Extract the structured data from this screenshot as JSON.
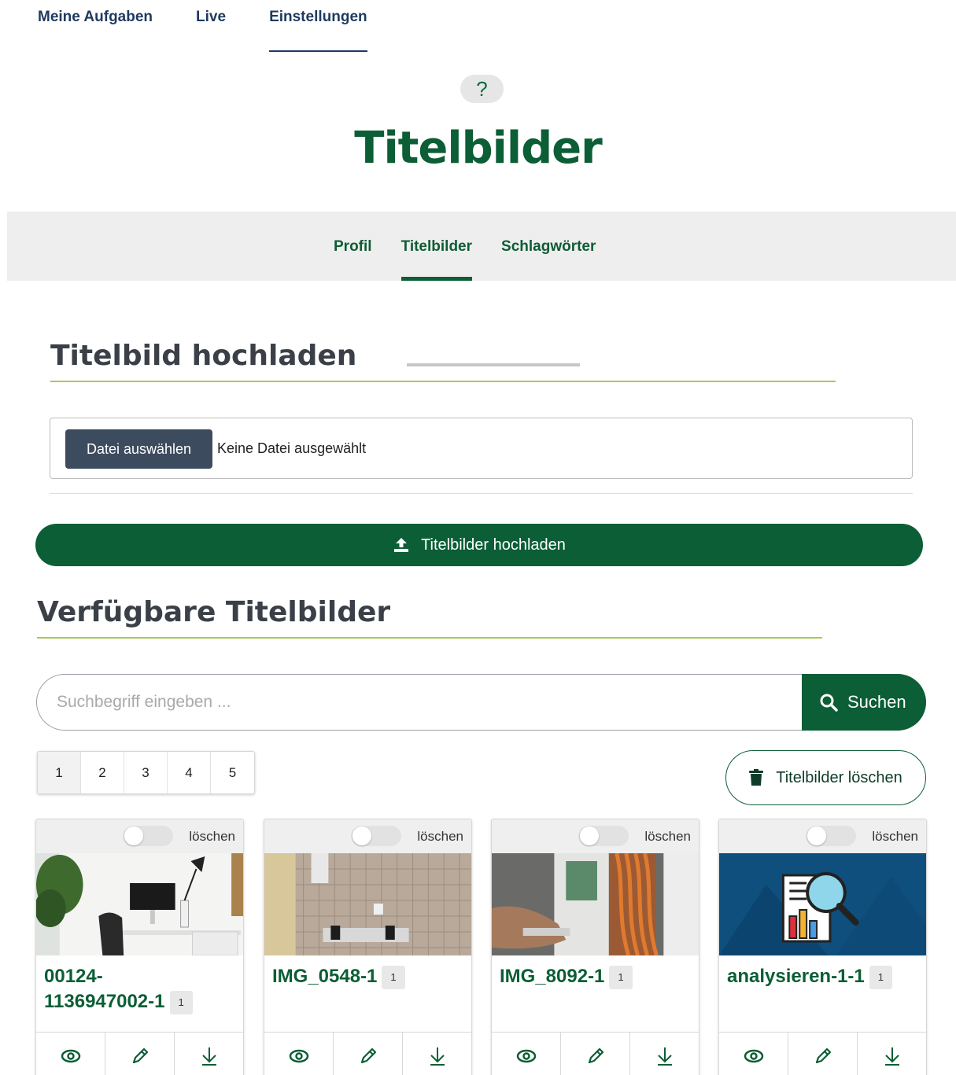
{
  "topnav": {
    "items": [
      "Meine Aufgaben",
      "Live",
      "Einstellungen"
    ],
    "active": "Einstellungen"
  },
  "help": {
    "label": "?"
  },
  "page_title": "Titelbilder",
  "subtabs": {
    "items": [
      "Profil",
      "Titelbilder",
      "Schlagwörter"
    ],
    "active": "Titelbilder"
  },
  "upload_section": {
    "heading": "Titelbild hochladen",
    "file_button": "Datei auswählen",
    "file_status": "Keine Datei ausgewählt",
    "submit_label": "Titelbilder hochladen"
  },
  "available_section": {
    "heading": "Verfügbare Titelbilder",
    "search_placeholder": "Suchbegriff eingeben ...",
    "search_button": "Suchen",
    "delete_button": "Titelbilder löschen",
    "pages": [
      "1",
      "2",
      "3",
      "4",
      "5"
    ],
    "current_page": "1"
  },
  "cards": [
    {
      "title": "00124-1136947002-1",
      "title_line1": "00124-",
      "title_line2": "1136947002-1",
      "count": "1",
      "toggle_label": "löschen",
      "image": "office-desk-photo"
    },
    {
      "title": "IMG_0548-1",
      "count": "1",
      "toggle_label": "löschen",
      "image": "electrical-panel-photo"
    },
    {
      "title": "IMG_8092-1",
      "count": "1",
      "toggle_label": "löschen",
      "image": "network-cable-photo"
    },
    {
      "title": "analysieren-1-1",
      "count": "1",
      "toggle_label": "löschen",
      "image": "analysis-illustration"
    }
  ],
  "card_actions": [
    "eye-icon",
    "pencil-icon",
    "download-icon"
  ],
  "colors": {
    "primary_green": "#0b5e35",
    "nav_blue": "#1e3a5f",
    "accent_lime": "#a7c957",
    "file_button_bg": "#3d4b5e"
  }
}
